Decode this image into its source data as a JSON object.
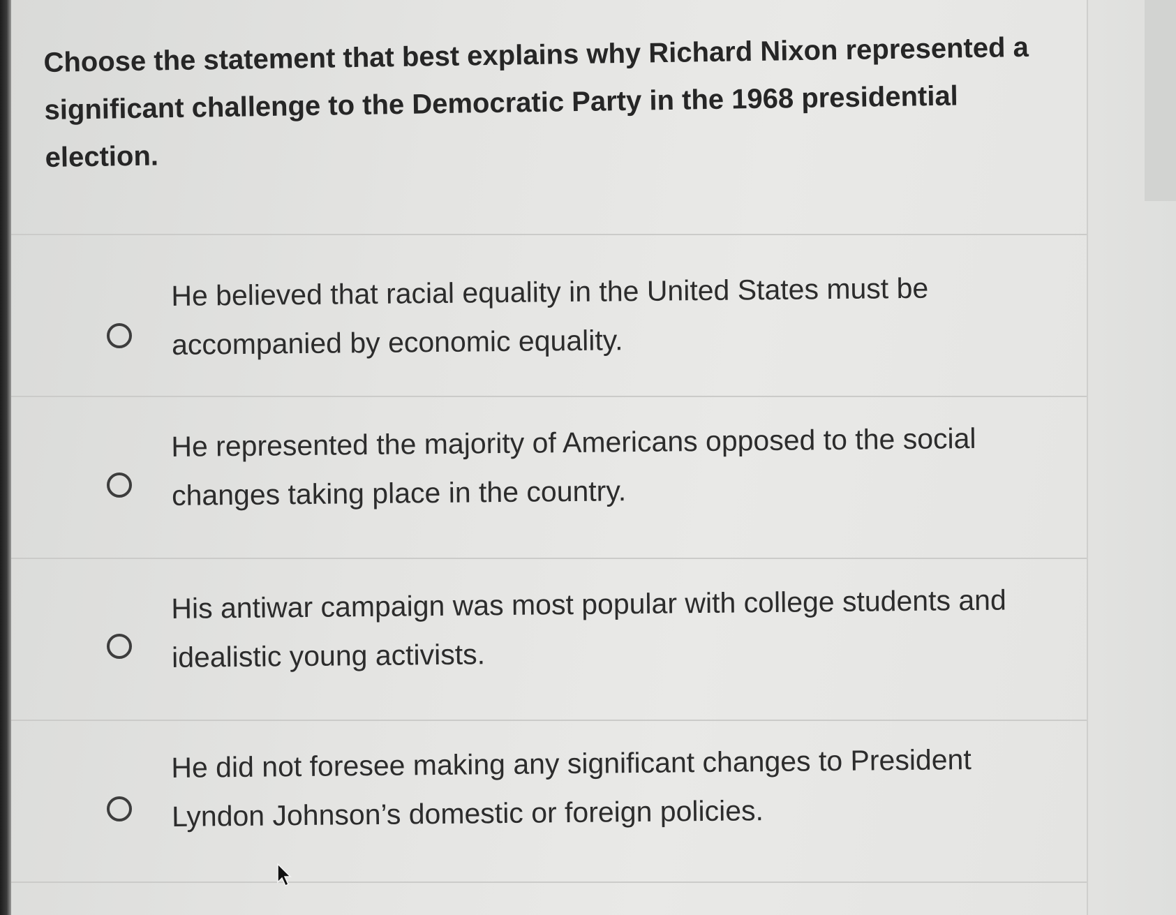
{
  "question": {
    "text": "Choose the statement that best explains why Richard Nixon represented a significant challenge to the Democratic Party in the 1968 presidential election."
  },
  "options": [
    {
      "label": "He believed that racial equality in the United States must be accompanied by economic equality.",
      "selected": false
    },
    {
      "label": "He represented the majority of Americans opposed to the social changes taking place in the country.",
      "selected": false
    },
    {
      "label": "His antiwar campaign was most popular with college students and idealistic young activists.",
      "selected": false
    },
    {
      "label": "He did not foresee making any significant changes to President Lyndon Johnson’s domestic or foreign policies.",
      "selected": false
    }
  ],
  "colors": {
    "text": "#2c2c2c",
    "radio_border": "#3d3d3d",
    "divider": "#cbcbc9"
  }
}
